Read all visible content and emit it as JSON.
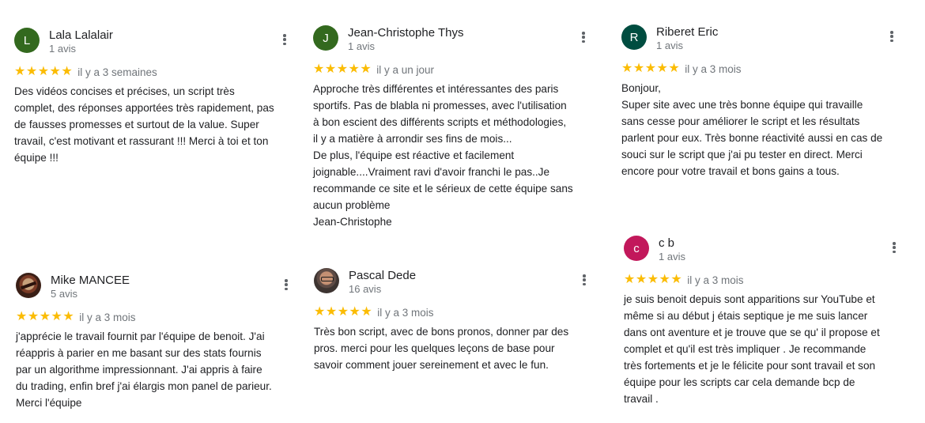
{
  "colors": {
    "star": "#fbbc04",
    "avatar_lala": "#33691e",
    "avatar_jc": "#33691e",
    "avatar_riberet": "#004d40",
    "avatar_cb": "#c2185b"
  },
  "reviews": {
    "lala": {
      "initial": "L",
      "name": "Lala Lalalair",
      "count": "1 avis",
      "stars": "★★★★★",
      "date": "il y a 3 semaines",
      "text": "Des vidéos concises et précises, un script très\ncomplet, des réponses apportées très rapidement, pas\nde fausses promesses et surtout de la value. Super\ntravail, c'est motivant et rassurant !!! Merci à toi et ton\néquipe !!!"
    },
    "jc": {
      "initial": "J",
      "name": "Jean-Christophe Thys",
      "count": "1 avis",
      "stars": "★★★★★",
      "date": "il y a un jour",
      "text": "Approche très différentes et intéressantes des paris\nsportifs. Pas de blabla ni promesses, avec l'utilisation\nà bon escient des différents scripts et méthodologies,\nil y a matière à arrondir ses fins de mois...\nDe plus, l'équipe est réactive et facilement\njoignable....Vraiment ravi d'avoir franchi le pas..Je\nrecommande ce site et le sérieux de cette équipe sans\naucun problème\nJean-Christophe"
    },
    "riberet": {
      "initial": "R",
      "name": "Riberet Eric",
      "count": "1 avis",
      "stars": "★★★★★",
      "date": "il y a 3 mois",
      "text": "Bonjour,\nSuper site avec une très bonne équipe qui travaille\nsans cesse pour améliorer le script et les résultats\nparlent pour eux. Très bonne réactivité aussi en cas de\nsouci sur le script que j'ai pu tester en  direct. Merci\nencore pour votre travail et bons gains a tous."
    },
    "mike": {
      "name": "Mike MANCEE",
      "count": "5 avis",
      "stars": "★★★★★",
      "date": "il y a 3 mois",
      "text": "j'apprécie le travail fournit par l'équipe de benoit. J'ai\nréappris à parier en me basant sur des stats fournis\npar un algorithme impressionnant. J'ai appris à faire\ndu trading, enfin bref j'ai élargis mon panel de parieur.\nMerci l'équipe"
    },
    "pascal": {
      "name": "Pascal Dede",
      "count": "16 avis",
      "stars": "★★★★★",
      "date": "il y a 3 mois",
      "text": "Très bon script, avec de bons pronos, donner par des\npros. merci pour les quelques leçons de base pour\nsavoir comment jouer sereinement et avec le fun."
    },
    "cb": {
      "initial": "c",
      "name": "c b",
      "count": "1 avis",
      "stars": "★★★★★",
      "date": "il y a 3 mois",
      "text": "je suis benoit depuis sont apparitions sur YouTube et\nmême si au début j étais  septique je me suis lancer\ndans ont aventure et je trouve que se qu' il propose et\ncomplet et qu'il est très impliquer . Je recommande\ntrès fortements et je le félicite pour sont travail et son\néquipe pour les scripts car cela demande bcp de\ntravail ."
    }
  }
}
